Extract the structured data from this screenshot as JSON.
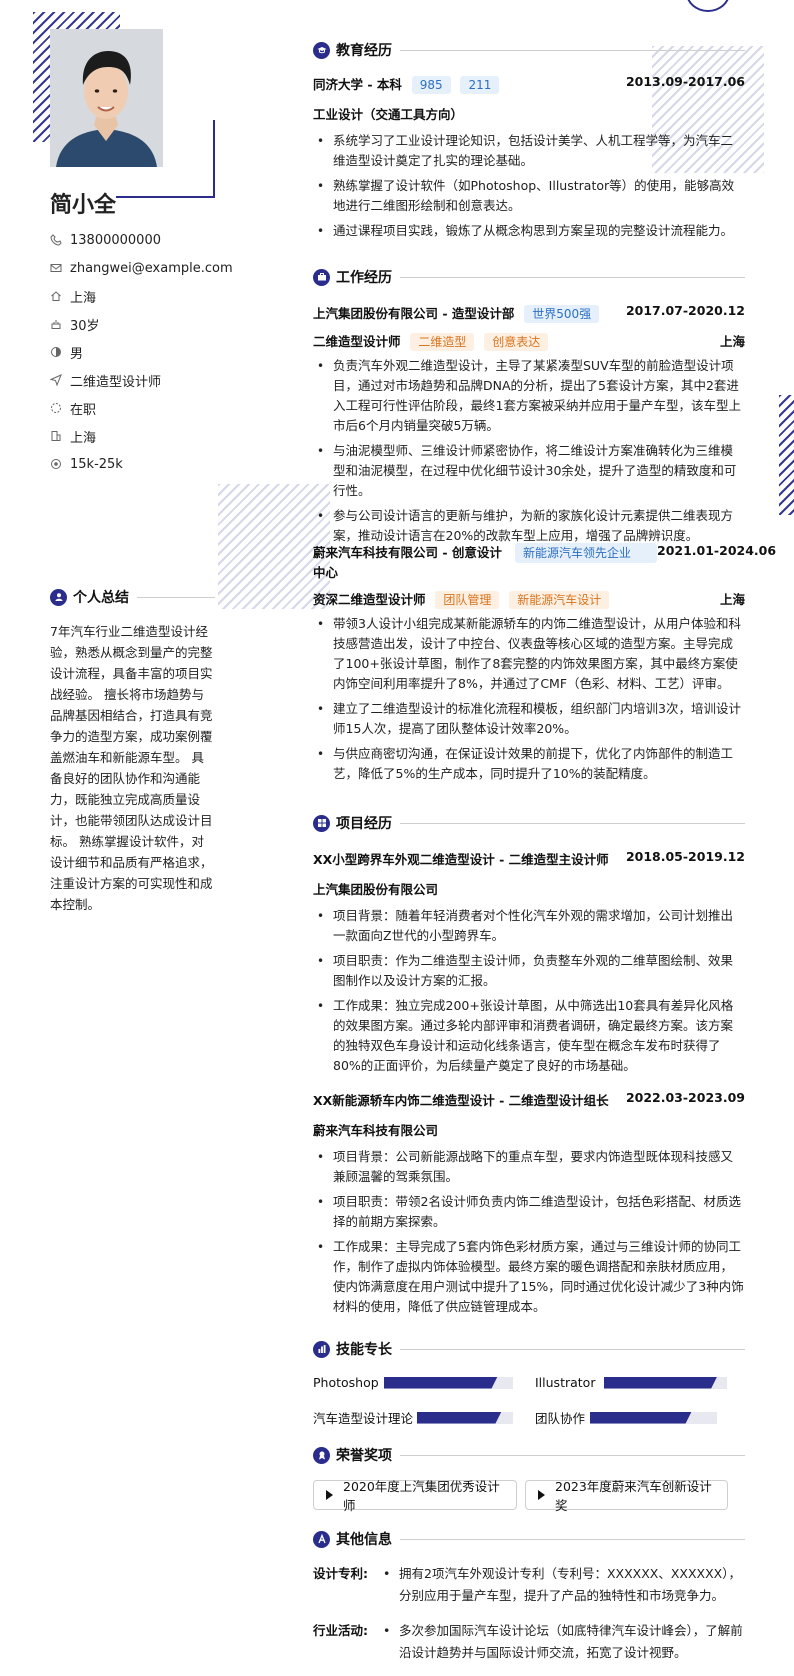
{
  "profile": {
    "name": "简小全",
    "info": [
      {
        "icon": "phone-icon",
        "text": "13800000000"
      },
      {
        "icon": "email-icon",
        "text": "zhangwei@example.com"
      },
      {
        "icon": "home-icon",
        "text": "上海"
      },
      {
        "icon": "cake-icon",
        "text": "30岁"
      },
      {
        "icon": "gender-icon",
        "text": "男"
      },
      {
        "icon": "send-icon",
        "text": "二维造型设计师"
      },
      {
        "icon": "status-icon",
        "text": "在职"
      },
      {
        "icon": "building-icon",
        "text": "上海"
      },
      {
        "icon": "money-icon",
        "text": "15k-25k"
      }
    ]
  },
  "summary": {
    "title": "个人总结",
    "text": "7年汽车行业二维造型设计经验，熟悉从概念到量产的完整设计流程，具备丰富的项目实战经验。 擅长将市场趋势与品牌基因相结合，打造具有竞争力的造型方案，成功案例覆盖燃油车和新能源车型。 具备良好的团队协作和沟通能力，既能独立完成高质量设计，也能带领团队达成设计目标。 熟练掌握设计软件，对设计细节和品质有严格追求，注重设计方案的可实现性和成本控制。"
  },
  "education": {
    "title": "教育经历",
    "school": "同济大学 - 本科",
    "tags": [
      "985",
      "211"
    ],
    "date": "2013.09-2017.06",
    "major": "工业设计（交通工具方向）",
    "bullets": [
      "系统学习了工业设计理论知识，包括设计美学、人机工程学等，为汽车二维造型设计奠定了扎实的理论基础。",
      "熟练掌握了设计软件（如Photoshop、Illustrator等）的使用，能够高效地进行二维图形绘制和创意表达。",
      "通过课程项目实践，锻炼了从概念构思到方案呈现的完整设计流程能力。"
    ]
  },
  "work": {
    "title": "工作经历",
    "jobs": [
      {
        "company": "上汽集团股份有限公司 - 造型设计部",
        "tag": "世界500强",
        "date": "2017.07-2020.12",
        "role": "二维造型设计师",
        "role_tags": [
          "二维造型",
          "创意表达"
        ],
        "city": "上海",
        "bullets": [
          "负责汽车外观二维造型设计，主导了某紧凑型SUV车型的前脸造型设计项目，通过对市场趋势和品牌DNA的分析，提出了5套设计方案，其中2套进入工程可行性评估阶段，最终1套方案被采纳并应用于量产车型，该车型上市后6个月内销量突破5万辆。",
          "与油泥模型师、三维设计师紧密协作，将二维设计方案准确转化为三维模型和油泥模型，在过程中优化细节设计30余处，提升了造型的精致度和可行性。",
          "参与公司设计语言的更新与维护，为新的家族化设计元素提供二维表现方案，推动设计语言在20%的改款车型上应用，增强了品牌辨识度。"
        ]
      },
      {
        "company": "蔚来汽车科技有限公司 - 创意设计中心",
        "tag": "新能源汽车领先企业",
        "date": "2021.01-2024.06",
        "role": "资深二维造型设计师",
        "role_tags": [
          "团队管理",
          "新能源汽车设计"
        ],
        "city": "上海",
        "bullets": [
          "带领3人设计小组完成某新能源轿车的内饰二维造型设计，从用户体验和科技感营造出发，设计了中控台、仪表盘等核心区域的造型方案。主导完成了100+张设计草图，制作了8套完整的内饰效果图方案，其中最终方案使内饰空间利用率提升了8%，并通过了CMF（色彩、材料、工艺）评审。",
          "建立了二维造型设计的标准化流程和模板，组织部门内培训3次，培训设计师15人次，提高了团队整体设计效率20%。",
          "与供应商密切沟通，在保证设计效果的前提下，优化了内饰部件的制造工艺，降低了5%的生产成本，同时提升了10%的装配精度。"
        ]
      }
    ]
  },
  "projects": {
    "title": "项目经历",
    "items": [
      {
        "name": "XX小型跨界车外观二维造型设计 - 二维造型主设计师",
        "date": "2018.05-2019.12",
        "company": "上汽集团股份有限公司",
        "bullets": [
          "项目背景：随着年轻消费者对个性化汽车外观的需求增加，公司计划推出一款面向Z世代的小型跨界车。",
          "项目职责：作为二维造型主设计师，负责整车外观的二维草图绘制、效果图制作以及设计方案的汇报。",
          "工作成果：独立完成200+张设计草图，从中筛选出10套具有差异化风格的效果图方案。通过多轮内部评审和消费者调研，确定最终方案。该方案的独特双色车身设计和运动化线条语言，使车型在概念车发布时获得了80%的正面评价，为后续量产奠定了良好的市场基础。"
        ]
      },
      {
        "name": "XX新能源轿车内饰二维造型设计 - 二维造型设计组长",
        "date": "2022.03-2023.09",
        "company": "蔚来汽车科技有限公司",
        "bullets": [
          "项目背景：公司新能源战略下的重点车型，要求内饰造型既体现科技感又兼顾温馨的驾乘氛围。",
          "项目职责：带领2名设计师负责内饰二维造型设计，包括色彩搭配、材质选择的前期方案探索。",
          "工作成果：主导完成了5套内饰色彩材质方案，通过与三维设计师的协同工作，制作了虚拟内饰体验模型。最终方案的暖色调搭配和亲肤材质应用，使内饰满意度在用户测试中提升了15%，同时通过优化设计减少了3种内饰材料的使用，降低了供应链管理成本。"
        ]
      }
    ]
  },
  "skills": {
    "title": "技能专长",
    "items": [
      {
        "name": "Photoshop",
        "level": 0.88
      },
      {
        "name": "Illustrator",
        "level": 0.92
      },
      {
        "name": "汽车造型设计理论",
        "level": 0.88
      },
      {
        "name": "团队协作",
        "level": 0.8
      }
    ]
  },
  "awards": {
    "title": "荣誉奖项",
    "items": [
      "2020年度上汽集团优秀设计师",
      "2023年度蔚来汽车创新设计奖"
    ]
  },
  "other": {
    "title": "其他信息",
    "items": [
      {
        "label": "设计专利:",
        "text": "拥有2项汽车外观设计专利（专利号：XXXXXX、XXXXXX），分别应用于量产车型，提升了产品的独特性和市场竞争力。"
      },
      {
        "label": "行业活动:",
        "text": "多次参加国际汽车设计论坛（如底特律汽车设计峰会），了解前沿设计趋势并与国际设计师交流，拓宽了设计视野。"
      }
    ]
  },
  "colors": {
    "accent": "#2a2d8c",
    "tag_blue_bg": "#e6f0fb",
    "tag_blue_text": "#2c6fc4",
    "tag_orange_bg": "#fdf0e2",
    "tag_orange_text": "#d9731d"
  }
}
